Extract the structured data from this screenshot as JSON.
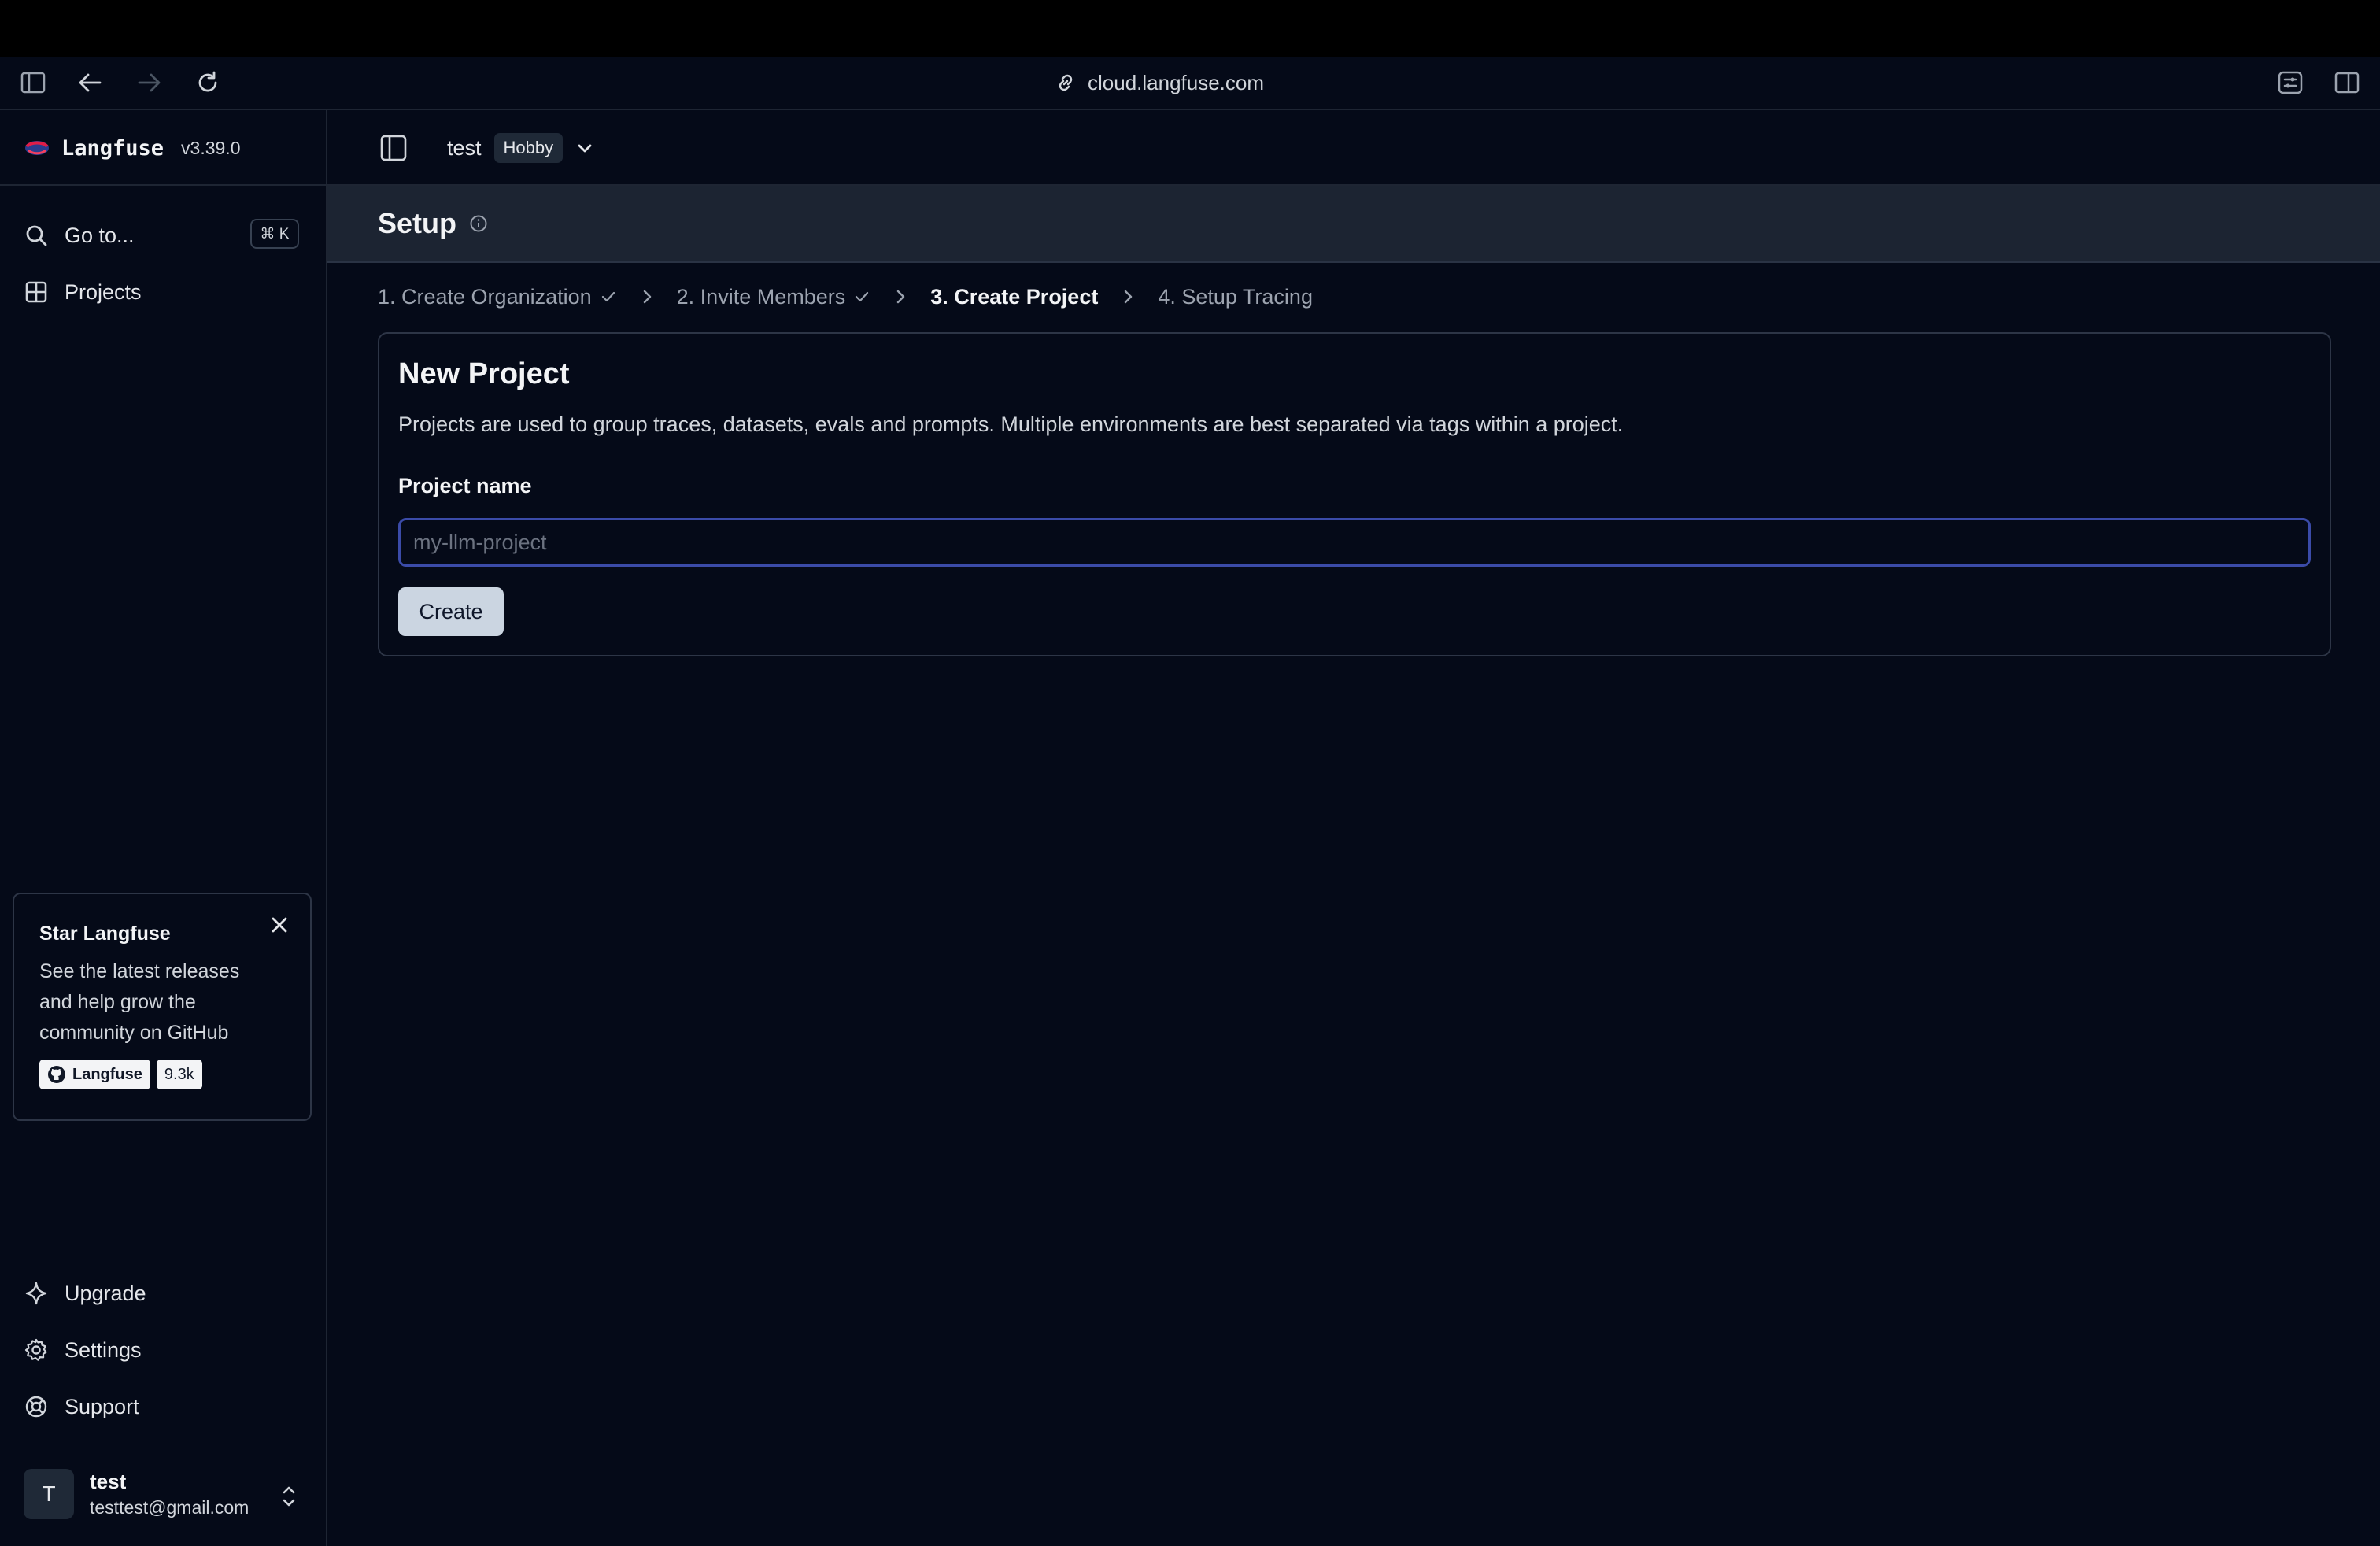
{
  "browser": {
    "url": "cloud.langfuse.com"
  },
  "sidebar": {
    "brand_name": "Langfuse",
    "version": "v3.39.0",
    "goto_label": "Go to...",
    "goto_shortcut": "⌘ K",
    "projects_label": "Projects",
    "star_card": {
      "title": "Star Langfuse",
      "description": "See the latest releases and help grow the community on GitHub",
      "github_label": "Langfuse",
      "star_count": "9.3k"
    },
    "upgrade_label": "Upgrade",
    "settings_label": "Settings",
    "support_label": "Support",
    "user": {
      "initial": "T",
      "name": "test",
      "email": "testtest@gmail.com"
    }
  },
  "header": {
    "org_name": "test",
    "plan_badge": "Hobby"
  },
  "setup": {
    "title": "Setup",
    "steps": [
      {
        "label": "1. Create Organization",
        "done": true
      },
      {
        "label": "2. Invite Members",
        "done": true
      },
      {
        "label": "3. Create Project",
        "active": true
      },
      {
        "label": "4. Setup Tracing"
      }
    ]
  },
  "new_project": {
    "title": "New Project",
    "description": "Projects are used to group traces, datasets, evals and prompts. Multiple environments are best separated via tags within a project.",
    "field_label": "Project name",
    "placeholder": "my-llm-project",
    "create_label": "Create"
  },
  "colors": {
    "background": "#050a18",
    "setup_bar": "#1c2432",
    "input_focus": "#3b4ba8",
    "button": "#cbd5e1"
  }
}
